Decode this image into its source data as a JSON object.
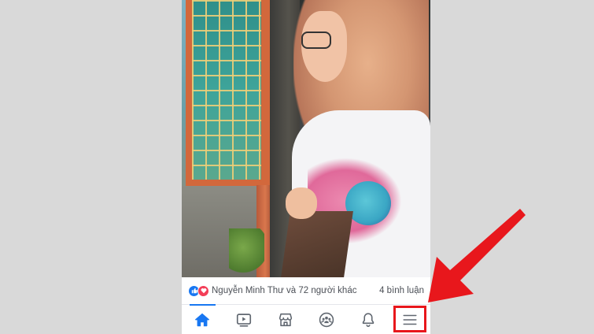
{
  "post": {
    "reactors_text": "Nguyễn Minh Thư và 72 người khác",
    "comments_text": "4 bình luận",
    "reactions": [
      "like-reaction",
      "love-reaction"
    ]
  },
  "tabbar": {
    "active_tab": "home",
    "tabs": [
      {
        "id": "home",
        "icon": "home-icon"
      },
      {
        "id": "watch",
        "icon": "video-icon"
      },
      {
        "id": "marketplace",
        "icon": "marketplace-icon"
      },
      {
        "id": "groups",
        "icon": "groups-icon"
      },
      {
        "id": "notifications",
        "icon": "bell-icon"
      },
      {
        "id": "menu",
        "icon": "hamburger-menu-icon"
      }
    ]
  },
  "colors": {
    "accent": "#1877f2",
    "annotation": "#e8171c",
    "icon": "#606770",
    "background": "#d9d9d9"
  }
}
